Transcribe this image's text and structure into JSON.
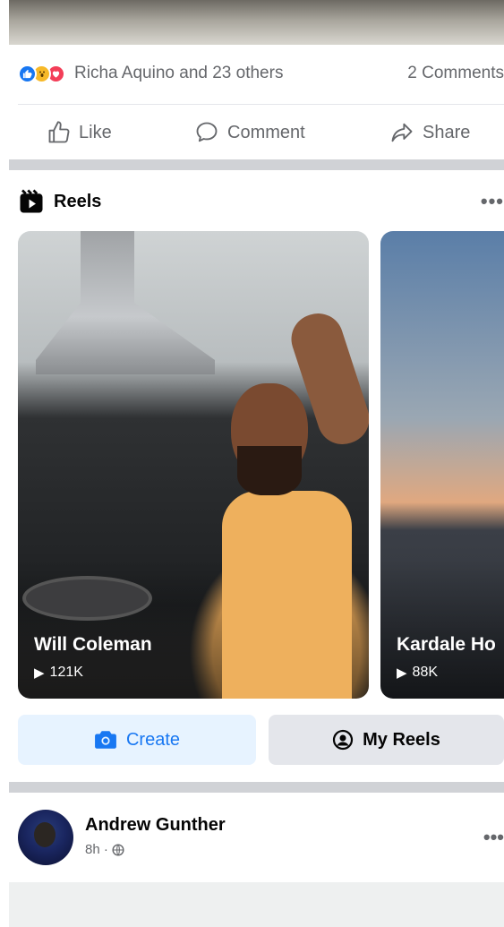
{
  "post_top": {
    "reactions": {
      "icons": [
        "like-reaction",
        "wow-reaction",
        "love-reaction"
      ],
      "summary": "Richa Aquino and 23 others",
      "comments": "2 Comments"
    },
    "actions": {
      "like": "Like",
      "comment": "Comment",
      "share": "Share"
    }
  },
  "reels": {
    "title": "Reels",
    "more": "•••",
    "cards": [
      {
        "name": "Will Coleman",
        "views": "121K"
      },
      {
        "name": "Kardale Ho",
        "views": "88K"
      }
    ],
    "create_label": "Create",
    "my_reels_label": "My Reels"
  },
  "next_post": {
    "author": "Andrew Gunther",
    "time": "8h ·",
    "more": "•••"
  },
  "colors": {
    "brand_blue": "#1877f2",
    "secondary_text": "#65676b",
    "divider": "#d0d2d6"
  }
}
